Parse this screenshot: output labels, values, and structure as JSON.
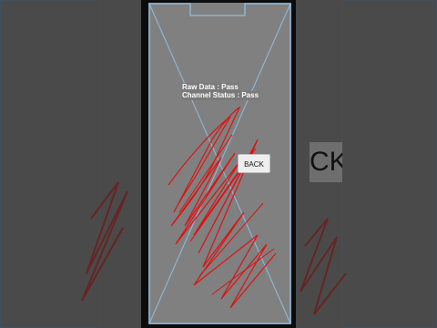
{
  "screen": {
    "raw_data_label": "Raw Data : Pass",
    "channel_status_label": "Channel Status : Pass",
    "back_button_label": "BACK"
  },
  "background": {
    "ghost_button_label": "CK"
  },
  "colors": {
    "screen_bg": "#808080",
    "guide_line": "#8fbce0",
    "scribble": "#e01010",
    "button_bg": "#eeeeee"
  },
  "icons": [
    "notch-outline",
    "diagonal-guide-lines",
    "touch-trace-scribble"
  ]
}
